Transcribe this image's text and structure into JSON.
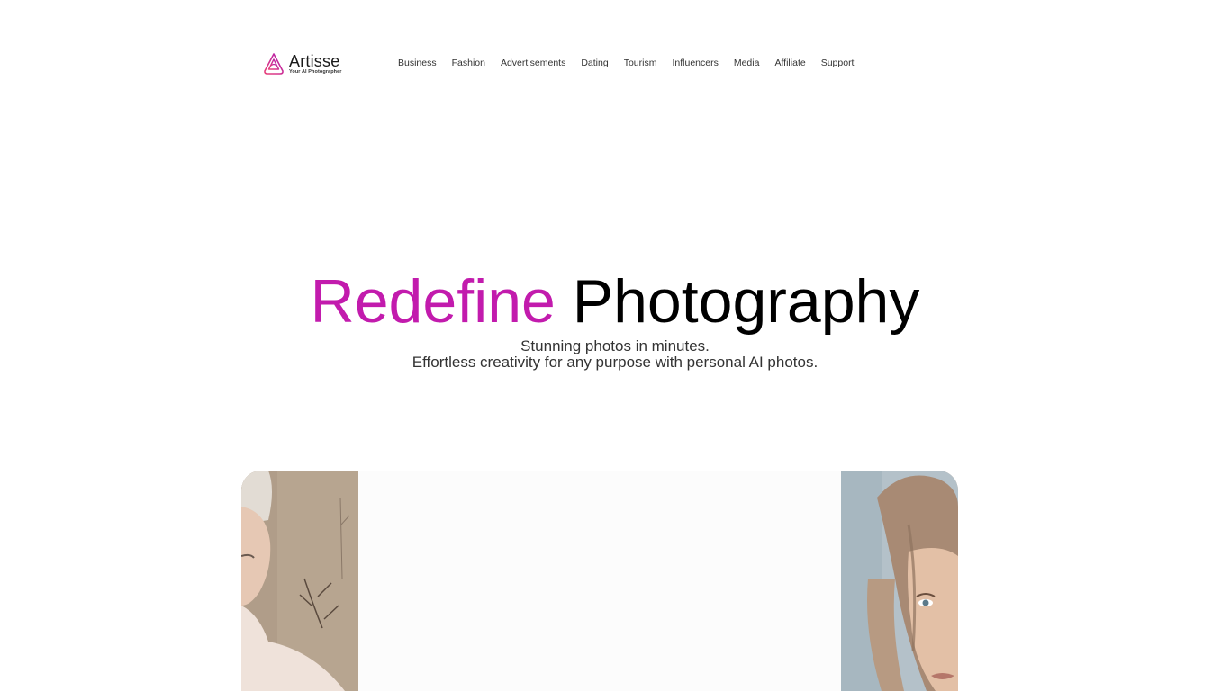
{
  "brand": {
    "name": "Artisse",
    "tagline": "Your AI Photographer",
    "accent_color": "#c21bad",
    "logo_gradient": [
      "#e8417a",
      "#b21fb0"
    ]
  },
  "nav": {
    "items": [
      {
        "label": "Business"
      },
      {
        "label": "Fashion"
      },
      {
        "label": "Advertisements"
      },
      {
        "label": "Dating"
      },
      {
        "label": "Tourism"
      },
      {
        "label": "Influencers"
      },
      {
        "label": "Media"
      },
      {
        "label": "Affiliate"
      },
      {
        "label": "Support"
      }
    ]
  },
  "hero": {
    "title_accent": "Redefine",
    "title_rest": "Photography",
    "subtitle_line1": "Stunning photos in minutes.",
    "subtitle_line2": "Effortless creativity for any purpose with personal AI photos."
  },
  "gallery": {
    "photos": [
      {
        "subject": "woman-outdoors-portrait"
      },
      {
        "subject": "woman-closeup-portrait"
      }
    ]
  }
}
